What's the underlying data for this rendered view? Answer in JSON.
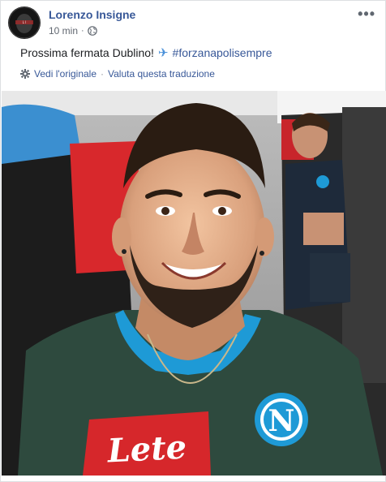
{
  "post": {
    "author": "Lorenzo Insigne",
    "timestamp": "10 min",
    "separator": "·",
    "privacy_icon": "globe-icon",
    "more_label": "•••",
    "text": "Prossima fermata Dublino!",
    "emoji_icon": "airplane-icon",
    "emoji": "✈",
    "hashtag": "#forzanapolisempre",
    "see_original": "Vedi l'originale",
    "rate_translation": "Valuta questa traduzione"
  },
  "photo": {
    "shirt_brand": "Lete",
    "colors": {
      "seat_red": "#d8282c",
      "shirt_green": "#2e4a3e",
      "napoli_blue": "#1e9ad6",
      "link_blue": "#385898"
    }
  }
}
